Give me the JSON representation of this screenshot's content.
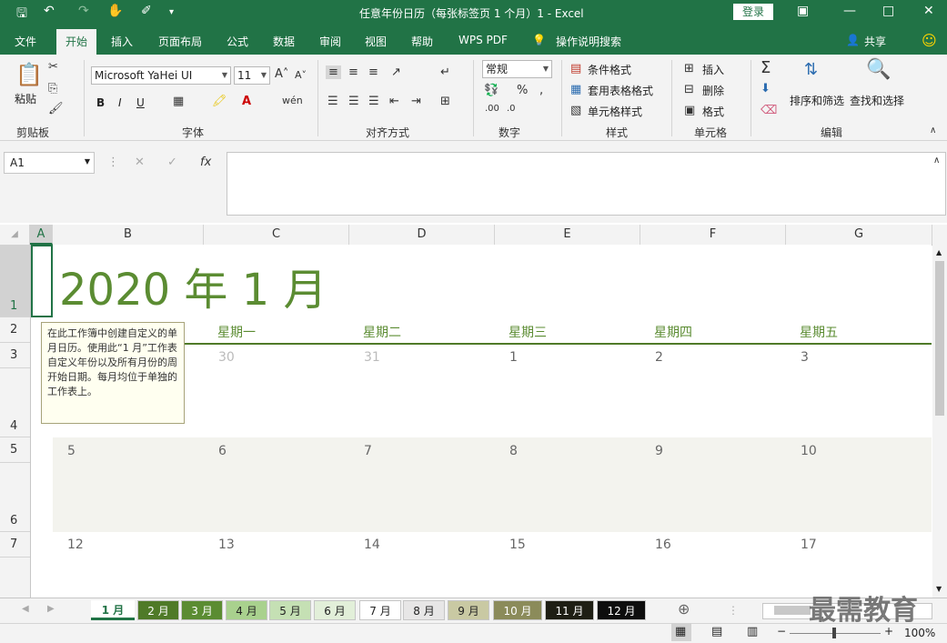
{
  "titlebar": {
    "title": "任意年份日历（每张标签页 1 个月）1  -  Excel",
    "login": "登录",
    "qat": {
      "save_icon": "save-icon",
      "undo_icon": "undo-icon",
      "redo_icon": "redo-icon"
    }
  },
  "tabs": [
    "文件",
    "开始",
    "插入",
    "页面布局",
    "公式",
    "数据",
    "审阅",
    "视图",
    "帮助",
    "WPS PDF"
  ],
  "tell_me": "操作说明搜索",
  "share": "共享",
  "ribbon": {
    "clipboard": {
      "paste": "粘贴",
      "label": "剪贴板"
    },
    "font": {
      "name": "Microsoft YaHei UI",
      "size": "11",
      "bold": "B",
      "italic": "I",
      "underline": "U",
      "label": "字体"
    },
    "align": {
      "label": "对齐方式"
    },
    "number": {
      "format": "常规",
      "label": "数字"
    },
    "styles": {
      "cond": "条件格式",
      "table": "套用表格格式",
      "cell": "单元格样式",
      "label": "样式"
    },
    "cells": {
      "insert": "插入",
      "delete": "删除",
      "format": "格式",
      "label": "单元格"
    },
    "editing": {
      "sort": "排序和筛选",
      "find": "查找和选择",
      "label": "编辑"
    }
  },
  "formula": {
    "namebox": "A1",
    "value": ""
  },
  "columns": [
    "A",
    "B",
    "C",
    "D",
    "E",
    "F",
    "G"
  ],
  "rows": [
    "1",
    "2",
    "3",
    "4",
    "5",
    "6",
    "7"
  ],
  "calendar": {
    "title": "2020 年 1 月",
    "weekdays": [
      "星期一",
      "星期二",
      "星期三",
      "星期四",
      "星期五"
    ],
    "week1": [
      "30",
      "31",
      "1",
      "2",
      "3"
    ],
    "week2": [
      "5",
      "6",
      "7",
      "8",
      "9",
      "10"
    ],
    "week3": [
      "12",
      "13",
      "14",
      "15",
      "16",
      "17"
    ]
  },
  "tooltip": "在此工作簿中创建自定义的单月日历。使用此“1 月”工作表自定义年份以及所有月份的周开始日期。每月均位于单独的工作表上。",
  "sheets": [
    "1 月",
    "2 月",
    "3 月",
    "4 月",
    "5 月",
    "6 月",
    "7 月",
    "8 月",
    "9 月",
    "10 月",
    "11 月",
    "12 月"
  ],
  "sheet_colors": [
    "#ffffff",
    "#4f7a28",
    "#5b8c32",
    "#a9d18e",
    "#c5e0b4",
    "#e2efd9",
    "#ffffff",
    "#e7e6e6",
    "#c9c9a3",
    "#8b8b5a",
    "#1e1e14",
    "#0d0d0d"
  ],
  "status": {
    "zoom": "100%"
  },
  "watermark": "最需教育"
}
